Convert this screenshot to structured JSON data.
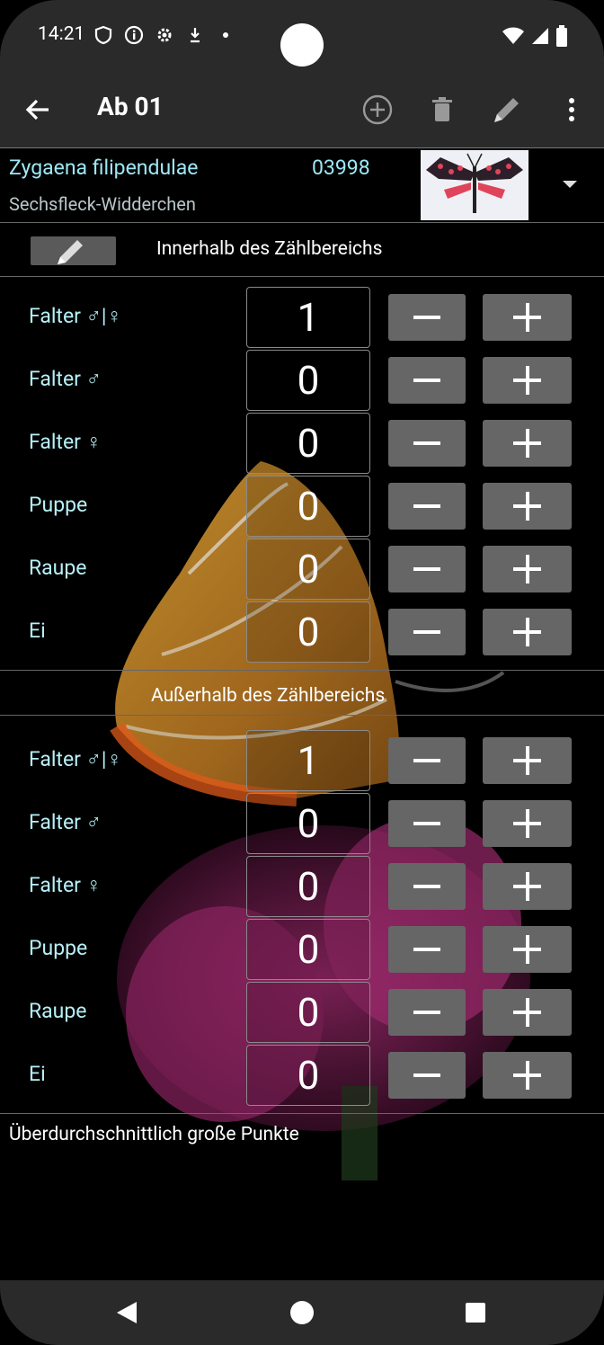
{
  "status_bar": {
    "time": "14:21"
  },
  "app_bar": {
    "title": "Ab 01"
  },
  "species": {
    "name": "Zygaena filipendulae",
    "code": "03998",
    "common_name": "Sechsfleck-Widderchen"
  },
  "inside": {
    "heading": "Innerhalb des Zählbereichs",
    "rows": [
      {
        "label": "Falter ♂|♀",
        "count": "1"
      },
      {
        "label": "Falter ♂",
        "count": "0"
      },
      {
        "label": "Falter ♀",
        "count": "0"
      },
      {
        "label": "Puppe",
        "count": "0"
      },
      {
        "label": "Raupe",
        "count": "0"
      },
      {
        "label": "Ei",
        "count": "0"
      }
    ]
  },
  "outside": {
    "heading": "Außerhalb des Zählbereichs",
    "rows": [
      {
        "label": "Falter ♂|♀",
        "count": "1"
      },
      {
        "label": "Falter ♂",
        "count": "0"
      },
      {
        "label": "Falter ♀",
        "count": "0"
      },
      {
        "label": "Puppe",
        "count": "0"
      },
      {
        "label": "Raupe",
        "count": "0"
      },
      {
        "label": "Ei",
        "count": "0"
      }
    ]
  },
  "note": "Überdurchschnittlich große Punkte",
  "colors": {
    "accent_text": "#9ee8f5",
    "button_bg": "#666666",
    "bar_bg": "#2a2a2a"
  },
  "icons": [
    "back-arrow-icon",
    "add-circle-icon",
    "delete-icon",
    "edit-pencil-icon",
    "overflow-menu-icon"
  ]
}
